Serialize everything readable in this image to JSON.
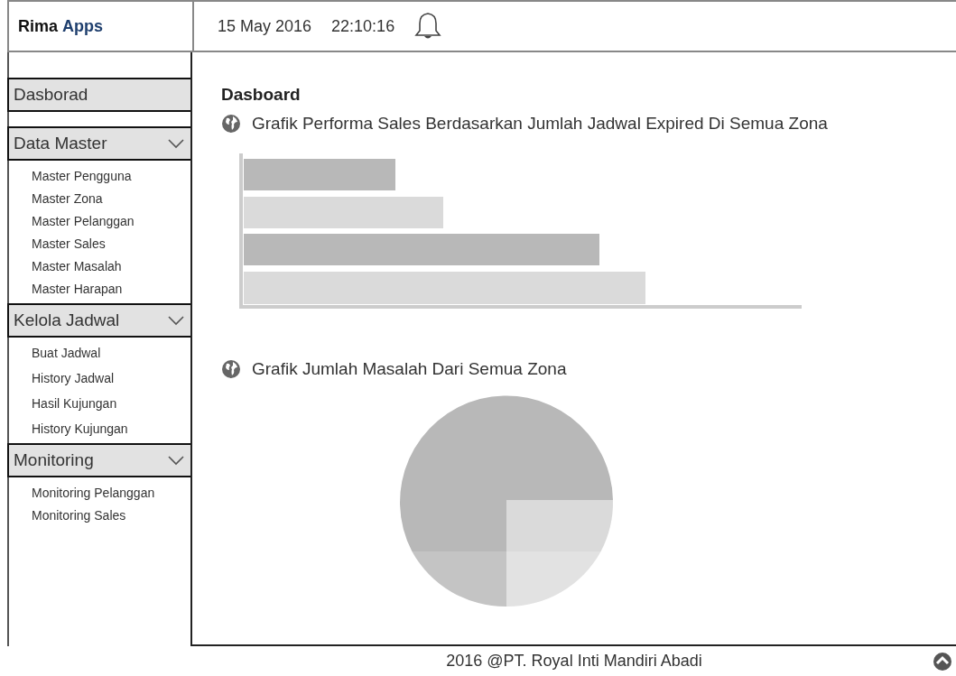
{
  "header": {
    "brand": "Rima",
    "brand_accent": "Apps",
    "date": "15 May 2016",
    "time": "22:10:16"
  },
  "sidebar": {
    "items": [
      {
        "kind": "link",
        "label": "Dasborad"
      },
      {
        "kind": "group",
        "label": "Data Master",
        "expanded": true,
        "children": [
          {
            "label": "Master Pengguna"
          },
          {
            "label": "Master Zona"
          },
          {
            "label": "Master Pelanggan"
          },
          {
            "label": "Master Sales"
          },
          {
            "label": "Master Masalah"
          },
          {
            "label": "Master Harapan"
          }
        ]
      },
      {
        "kind": "group",
        "label": "Kelola Jadwal",
        "expanded": true,
        "children": [
          {
            "label": "Buat Jadwal"
          },
          {
            "label": "History Jadwal"
          },
          {
            "label": "Hasil Kujungan"
          },
          {
            "label": "History Kujungan"
          }
        ]
      },
      {
        "kind": "group",
        "label": "Monitoring",
        "expanded": true,
        "children": [
          {
            "label": "Monitoring Pelanggan"
          },
          {
            "label": "Monitoring Sales"
          }
        ]
      }
    ]
  },
  "main": {
    "title": "Dasboard",
    "charts": [
      {
        "kind": "bar",
        "title": "Grafik Performa Sales Berdasarkan Jumlah Jadwal Expired Di Semua Zona"
      },
      {
        "kind": "pie",
        "title": "Grafik Jumlah Masalah Dari Semua Zona"
      }
    ]
  },
  "footer": {
    "text": "2016 @PT. Royal Inti Mandiri Abadi"
  }
}
